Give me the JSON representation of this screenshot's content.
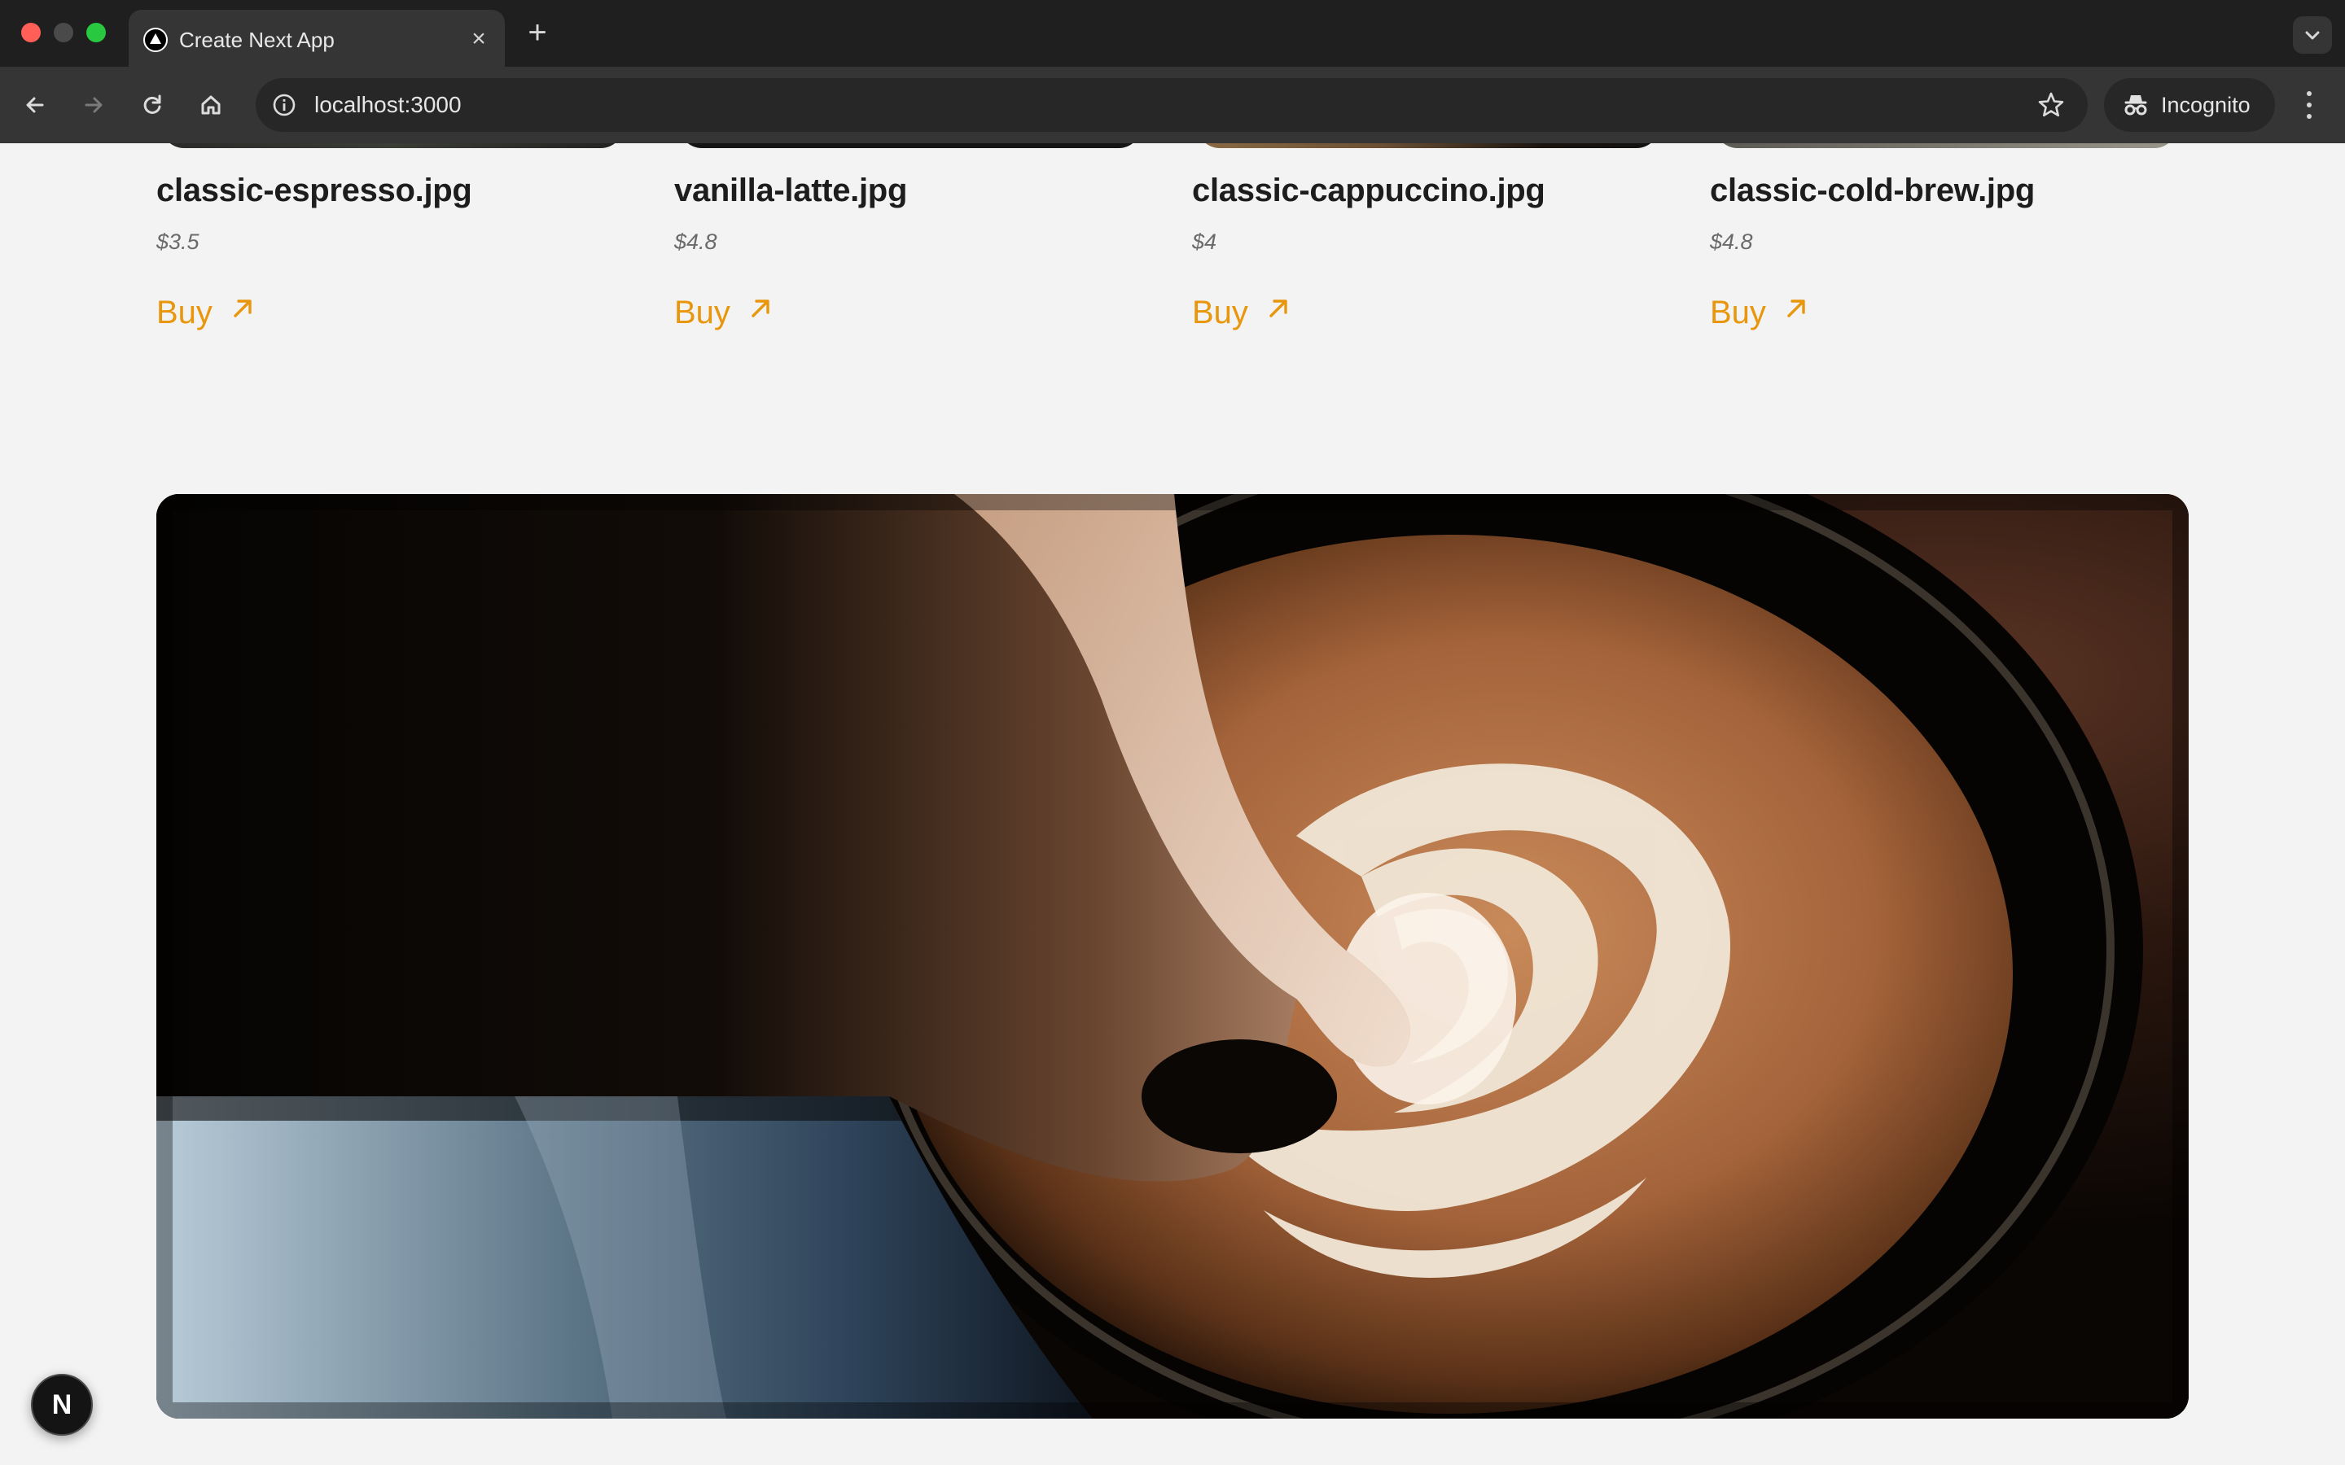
{
  "browser": {
    "tab_title": "Create Next App",
    "url": "localhost:3000",
    "incognito_label": "Incognito"
  },
  "products": [
    {
      "name": "classic-espresso.jpg",
      "price": "$3.5",
      "buy_label": "Buy"
    },
    {
      "name": "vanilla-latte.jpg",
      "price": "$4.8",
      "buy_label": "Buy"
    },
    {
      "name": "classic-cappuccino.jpg",
      "price": "$4",
      "buy_label": "Buy"
    },
    {
      "name": "classic-cold-brew.jpg",
      "price": "$4.8",
      "buy_label": "Buy"
    }
  ],
  "hero": {
    "image_subject": "latte art being poured into a cup"
  },
  "dev_badge": {
    "label": "N"
  },
  "colors": {
    "accent": "#e8960c",
    "page_background": "#f3f3f3",
    "chrome_dark": "#1f1f1f",
    "chrome_toolbar": "#353535"
  },
  "icons": {
    "tab_favicon": "vercel-triangle-icon",
    "back": "arrow-left-icon",
    "forward": "arrow-right-icon",
    "reload": "reload-icon",
    "home": "home-icon",
    "site_info": "info-icon",
    "bookmark": "star-icon",
    "incognito": "incognito-icon",
    "menu": "kebab-menu-icon",
    "buy": "arrow-up-right-icon"
  }
}
